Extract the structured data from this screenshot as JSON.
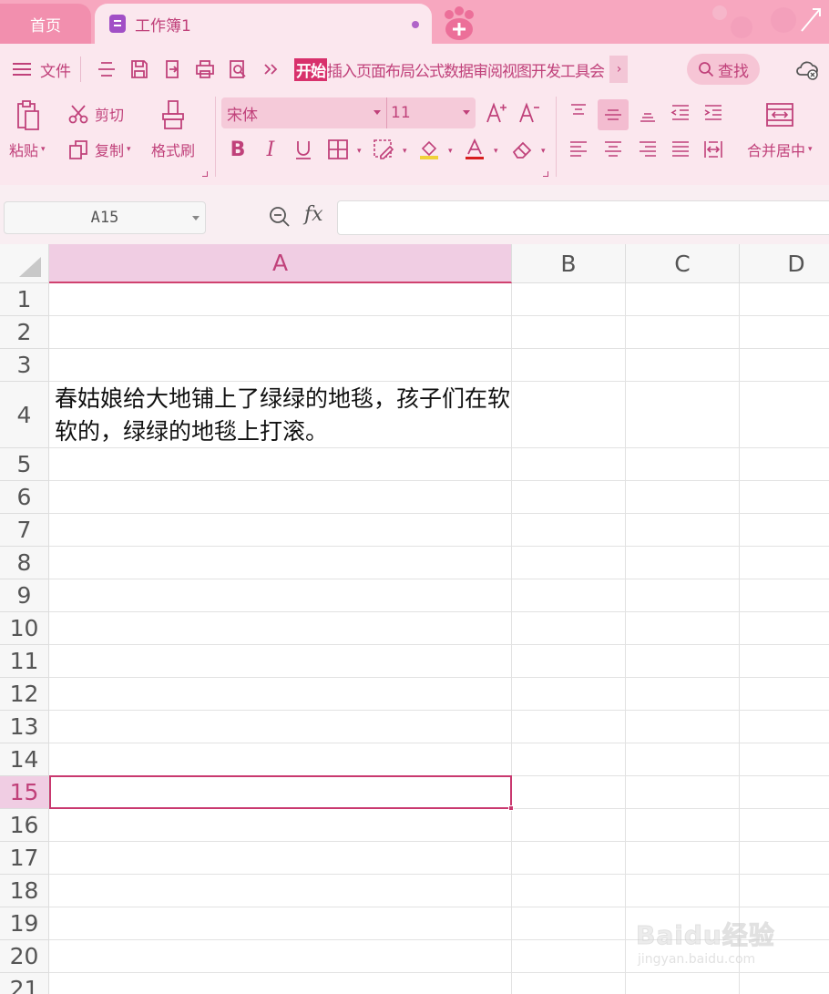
{
  "tabs": {
    "home_label": "首页",
    "workbook_label": "工作簿1"
  },
  "menu": {
    "file_label": "文件",
    "ribbon_tabs": [
      "开始",
      "插入",
      "页面布局",
      "公式",
      "数据",
      "审阅",
      "视图",
      "开发工具",
      "会"
    ],
    "active_tab": "开始",
    "search_label": "查找"
  },
  "ribbon": {
    "paste_label": "粘贴",
    "cut_label": "剪切",
    "copy_label": "复制",
    "format_painter_label": "格式刷",
    "font_name": "宋体",
    "font_size": "11",
    "merge_center_label": "合并居中"
  },
  "formula_bar": {
    "name_box": "A15",
    "fx_label": "fx",
    "formula_value": ""
  },
  "sheet": {
    "columns": [
      "A",
      "B",
      "C",
      "D"
    ],
    "rows": [
      "1",
      "2",
      "3",
      "4",
      "5",
      "6",
      "7",
      "8",
      "9",
      "10",
      "11",
      "12",
      "13",
      "14",
      "15",
      "16",
      "17",
      "18",
      "19",
      "20",
      "21"
    ],
    "selected_column": "A",
    "selected_row": "15",
    "cell_A4": "春姑娘给大地铺上了绿绿的地毯，孩子们在软软的，绿绿的地毯上打滚。"
  },
  "watermark": {
    "brand": "Baidu经验",
    "url": "jingyan.baidu.com"
  },
  "colors": {
    "accent": "#c0417a",
    "active_tab_bg": "#d8316c",
    "tab_bar_bg": "#f7a7bf",
    "ribbon_bg": "#fbe7ee",
    "selection_border": "#c9386f"
  }
}
